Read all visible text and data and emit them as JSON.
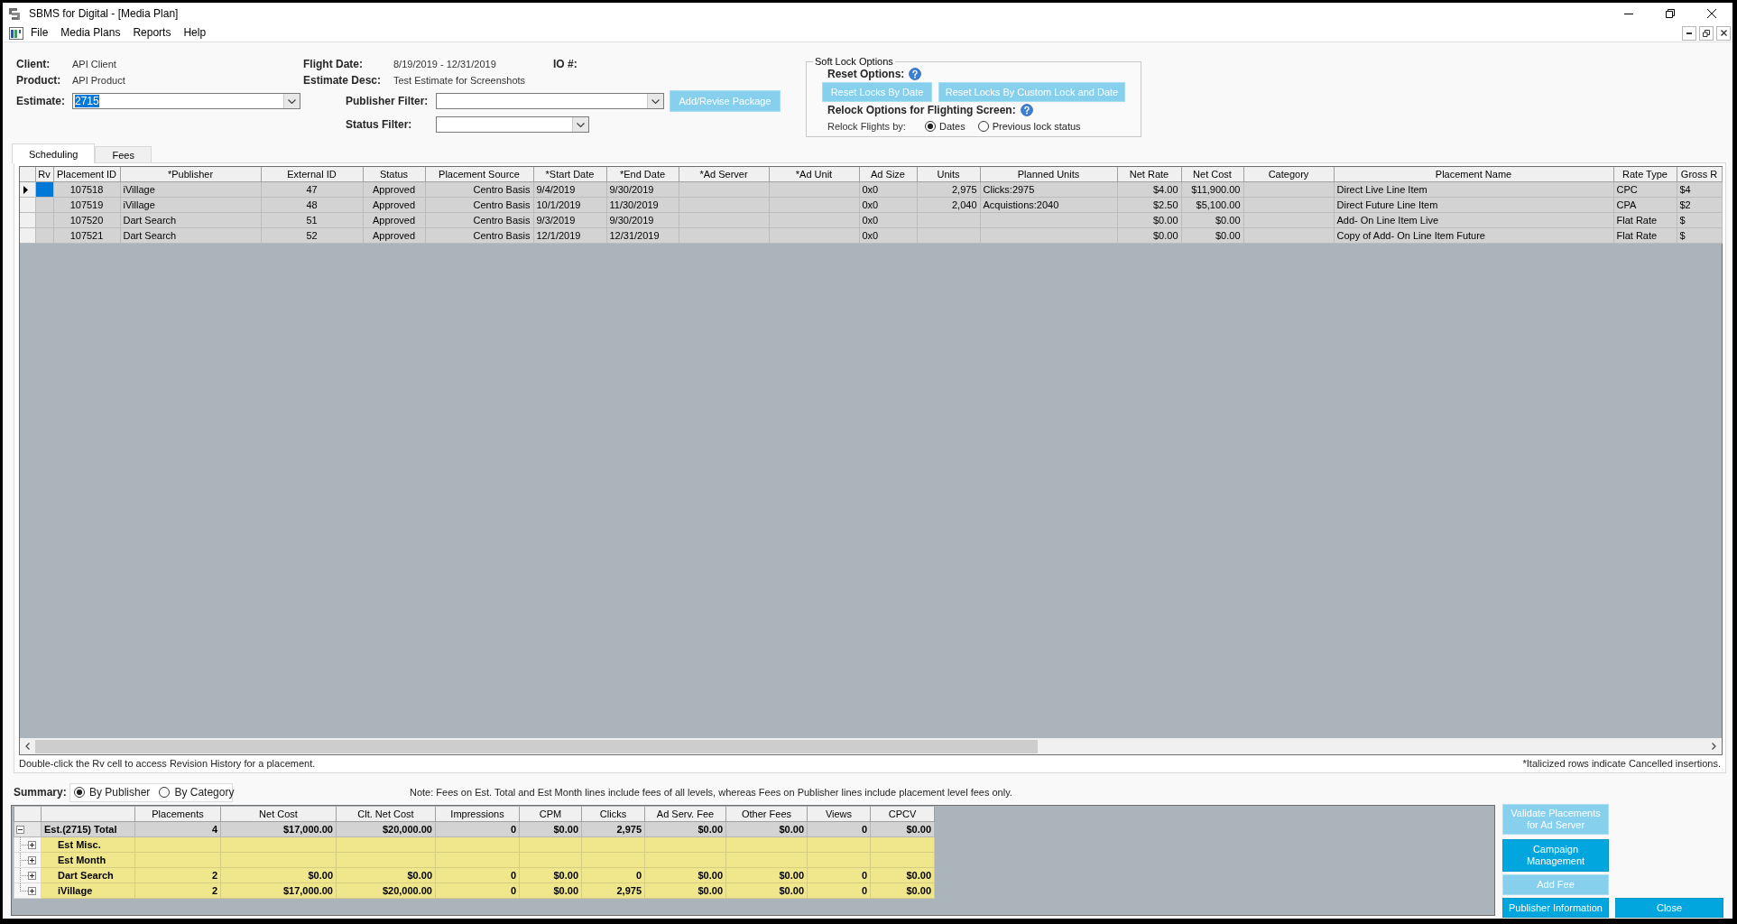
{
  "window": {
    "title": "SBMS for Digital - [Media Plan]"
  },
  "menu": [
    {
      "label": "File"
    },
    {
      "label": "Media Plans"
    },
    {
      "label": "Reports"
    },
    {
      "label": "Help"
    }
  ],
  "header": {
    "client": {
      "label": "Client:",
      "value": "API Client"
    },
    "product": {
      "label": "Product:",
      "value": "API Product"
    },
    "flight_date": {
      "label": "Flight Date:",
      "value": "8/19/2019 - 12/31/2019"
    },
    "estimate_desc": {
      "label": "Estimate Desc:",
      "value": "Test Estimate for Screenshots"
    },
    "io_number": {
      "label": "IO #:"
    },
    "estimate": {
      "label": "Estimate:",
      "value": "2715",
      "value_selected": true
    },
    "publisher_filter": {
      "label": "Publisher Filter:"
    },
    "status_filter": {
      "label": "Status Filter:"
    },
    "add_package_button": {
      "label": "Add/Revise Package",
      "disabled": true
    }
  },
  "soft_lock": {
    "title": "Soft Lock Options",
    "reset_label": "Reset Options:",
    "reset_buttons": [
      {
        "label": "Reset Locks By Date",
        "disabled": true
      },
      {
        "label": "Reset Locks By Custom Lock and Date",
        "disabled": true
      }
    ],
    "relock_label": "Relock Options for Flighting Screen:",
    "relock_by_label": "Relock Flights by:",
    "relock_options": [
      {
        "label": "Dates",
        "selected": true
      },
      {
        "label": "Previous lock status",
        "selected": false
      }
    ]
  },
  "tabs": [
    {
      "label": "Scheduling",
      "selected": true
    },
    {
      "label": "Fees",
      "selected": false
    }
  ],
  "grid": {
    "columns": [
      "Rv",
      "Placement ID",
      "*Publisher",
      "External ID",
      "Status",
      "Placement Source",
      "*Start Date",
      "*End Date",
      "*Ad Server",
      "*Ad Unit",
      "Ad Size",
      "Units",
      "Planned Units",
      "Net Rate",
      "Net Cost",
      "Category",
      "Placement Name",
      "Rate Type",
      "Gross R"
    ],
    "rows": [
      {
        "selected": true,
        "cells": [
          null,
          "107518",
          "iVillage",
          "47",
          "Approved",
          "Centro Basis",
          "9/4/2019",
          "9/30/2019",
          null,
          null,
          "0x0",
          "2,975",
          "Clicks:2975",
          "$4.00",
          "$11,900.00",
          null,
          "Direct Live Line Item",
          "CPC",
          "$4"
        ]
      },
      {
        "selected": false,
        "cells": [
          null,
          "107519",
          "iVillage",
          "48",
          "Approved",
          "Centro Basis",
          "10/1/2019",
          "11/30/2019",
          null,
          null,
          "0x0",
          "2,040",
          "Acquistions:2040",
          "$2.50",
          "$5,100.00",
          null,
          "Direct Future Line Item",
          "CPA",
          "$2"
        ]
      },
      {
        "selected": false,
        "cells": [
          null,
          "107520",
          "Dart Search",
          "51",
          "Approved",
          "Centro Basis",
          "9/3/2019",
          "9/30/2019",
          null,
          null,
          "0x0",
          null,
          null,
          "$0.00",
          "$0.00",
          null,
          "Add- On Line Item Live",
          "Flat Rate",
          "$"
        ]
      },
      {
        "selected": false,
        "cells": [
          null,
          "107521",
          "Dart Search",
          "52",
          "Approved",
          "Centro Basis",
          "12/1/2019",
          "12/31/2019",
          null,
          null,
          "0x0",
          null,
          null,
          "$0.00",
          "$0.00",
          null,
          "Copy of Add- On Line Item Future",
          "Flat Rate",
          "$"
        ]
      }
    ],
    "hint": "Double-click the Rv cell to access Revision History for a placement.",
    "legend": "*Italicized rows indicate Cancelled insertions."
  },
  "summary": {
    "label": "Summary:",
    "group_by": [
      {
        "label": "By Publisher",
        "selected": true
      },
      {
        "label": "By Category",
        "selected": false
      }
    ],
    "note": "Note: Fees on Est. Total and Est Month lines include fees of all levels, whereas Fees on Publisher lines include placement level fees only.",
    "columns": [
      "Placements",
      "Net Cost",
      "Clt. Net Cost",
      "Impressions",
      "CPM",
      "Clicks",
      "Ad Serv. Fee",
      "Other Fees",
      "Views",
      "CPCV"
    ],
    "rows": [
      {
        "name": "Est.(2715) Total",
        "expanded": true,
        "values": [
          "4",
          "$17,000.00",
          "$20,000.00",
          "0",
          "$0.00",
          "2,975",
          "$0.00",
          "$0.00",
          "0",
          "$0.00"
        ],
        "children": [
          {
            "name": "Est Misc.",
            "expanded": false
          },
          {
            "name": "Est Month",
            "expanded": false
          },
          {
            "name": "Dart Search",
            "expanded": false,
            "values": [
              "2",
              "$0.00",
              "$0.00",
              "0",
              "$0.00",
              "0",
              "$0.00",
              "$0.00",
              "0",
              "$0.00"
            ]
          },
          {
            "name": "iVillage",
            "expanded": false,
            "values": [
              "2",
              "$17,000.00",
              "$20,000.00",
              "0",
              "$0.00",
              "2,975",
              "$0.00",
              "$0.00",
              "0",
              "$0.00"
            ]
          }
        ]
      }
    ]
  },
  "action_buttons": [
    {
      "label": "Validate Placements for Ad Server",
      "disabled": true
    },
    {
      "label": "Campaign Management",
      "disabled": false
    },
    {
      "label": "Add Fee",
      "disabled": true
    },
    {
      "label": "Publisher Information",
      "disabled": false
    }
  ],
  "close_button": {
    "label": "Close",
    "disabled": false
  }
}
